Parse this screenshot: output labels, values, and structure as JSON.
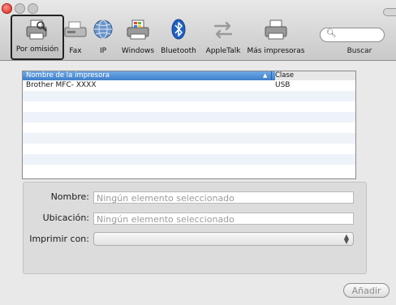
{
  "toolbar": {
    "items": [
      {
        "label": "Por omisión",
        "icon": "printer-icon"
      },
      {
        "label": "Fax",
        "icon": "fax-icon"
      },
      {
        "label": "IP",
        "icon": "globe-icon"
      },
      {
        "label": "Windows",
        "icon": "windows-printer-icon"
      },
      {
        "label": "Bluetooth",
        "icon": "bluetooth-icon"
      },
      {
        "label": "AppleTalk",
        "icon": "appletalk-icon"
      },
      {
        "label": "Más impresoras",
        "icon": "more-printers-icon"
      }
    ],
    "search_label": "Buscar",
    "search_icon": "search-icon"
  },
  "printer_list": {
    "columns": {
      "name": "Nombre de la impresora",
      "kind": "Clase"
    },
    "rows": [
      {
        "name": "Brother MFC- XXXX",
        "kind": "USB"
      }
    ]
  },
  "details": {
    "name_label": "Nombre:",
    "name_value": "Ningún elemento seleccionado",
    "location_label": "Ubicación:",
    "location_value": "Ningún elemento seleccionado",
    "print_with_label": "Imprimir con:",
    "print_with_value": ""
  },
  "add_button_label": "Añadir",
  "colors": {
    "selection": "#3f7fcb",
    "close_light": "#d7261b"
  }
}
